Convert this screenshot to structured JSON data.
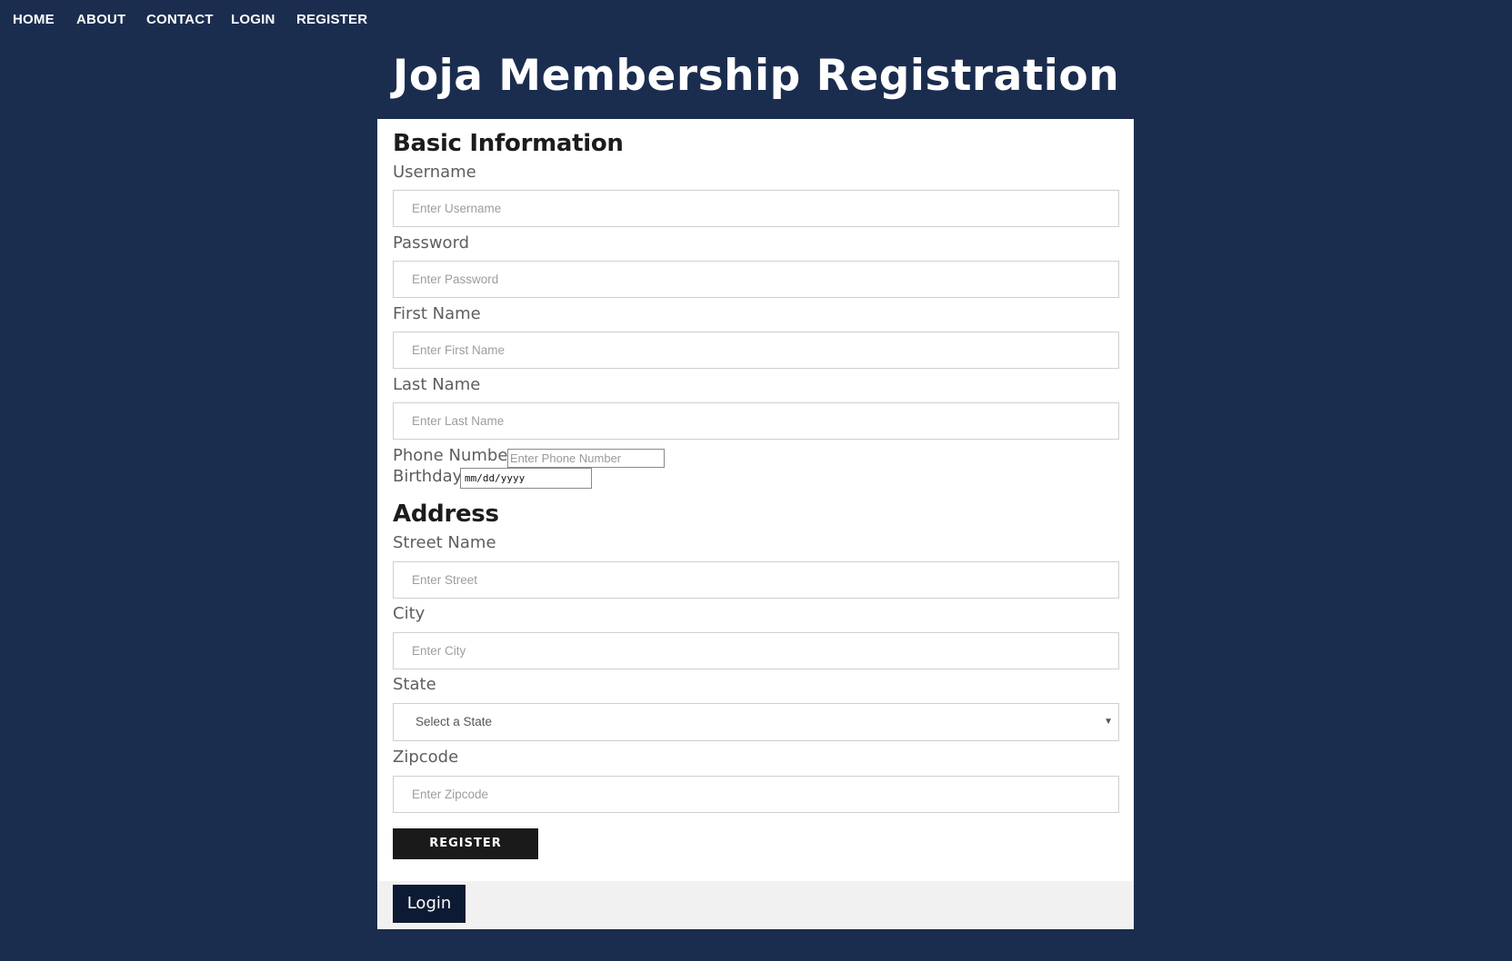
{
  "nav": {
    "items": [
      "HOME",
      "ABOUT",
      "CONTACT",
      "LOGIN",
      "REGISTER"
    ]
  },
  "page_title": "Joja Membership Registration",
  "basic": {
    "heading": "Basic Information",
    "username_label": "Username",
    "username_placeholder": "Enter Username",
    "password_label": "Password",
    "password_placeholder": "Enter Password",
    "first_label": "First Name",
    "first_placeholder": "Enter First Name",
    "last_label": "Last Name",
    "last_placeholder": "Enter Last Name",
    "phone_label": "Phone Number",
    "phone_placeholder": "Enter Phone Number",
    "birthday_label": "Birthday",
    "birthday_value": "mm/dd/yyyy"
  },
  "address": {
    "heading": "Address",
    "street_label": "Street Name",
    "street_placeholder": "Enter Street",
    "city_label": "City",
    "city_placeholder": "Enter City",
    "state_label": "State",
    "state_selected": "Select a State",
    "zip_label": "Zipcode",
    "zip_placeholder": "Enter Zipcode"
  },
  "register_button": "REGISTER",
  "login_button": "Login",
  "colors": {
    "background": "#1b2d4f",
    "card": "#ffffff",
    "footer": "#f1f1f1",
    "register_btn": "#1a1a1a",
    "login_btn": "#0d1a33"
  }
}
